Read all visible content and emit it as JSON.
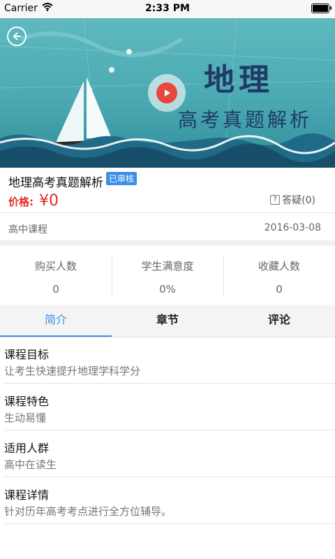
{
  "status_bar": {
    "carrier": "Carrier",
    "time": "2:33 PM"
  },
  "banner": {
    "title": "地理",
    "subtitle": "高考真题解析",
    "play_color": "#e8473f"
  },
  "course": {
    "title": "地理高考真题解析",
    "badge": "已审核",
    "price_label": "价格:",
    "price_value": "¥0",
    "qa_label": "答疑(0)",
    "category": "高中课程",
    "date": "2016-03-08"
  },
  "stats": [
    {
      "label": "购买人数",
      "value": "0"
    },
    {
      "label": "学生满意度",
      "value": "0%"
    },
    {
      "label": "收藏人数",
      "value": "0"
    }
  ],
  "tabs": [
    {
      "label": "简介",
      "active": true
    },
    {
      "label": "章节",
      "active": false
    },
    {
      "label": "评论",
      "active": false
    }
  ],
  "details": [
    {
      "heading": "课程目标",
      "text": "让考生快速提升地理学科学分"
    },
    {
      "heading": "课程特色",
      "text": "生动易懂"
    },
    {
      "heading": "适用人群",
      "text": "高中在读生"
    },
    {
      "heading": "课程详情",
      "text": "针对历年高考考点进行全方位辅导。"
    }
  ],
  "colors": {
    "accent": "#3b8fe6",
    "price": "#e12b2b"
  }
}
